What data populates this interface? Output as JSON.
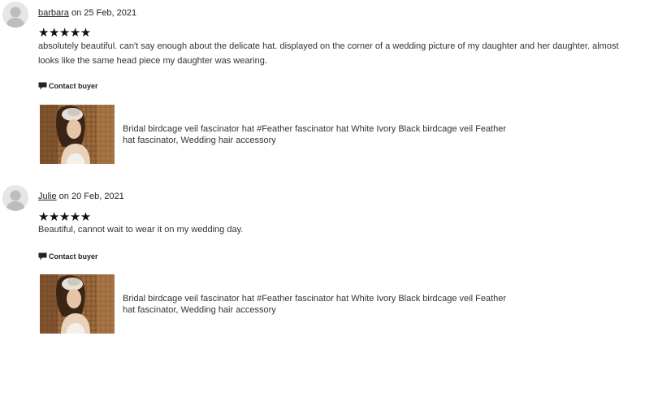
{
  "reviews": [
    {
      "reviewer": "barbara",
      "date_text": " on 25 Feb, 2021",
      "stars": "★★★★★",
      "rating": 5,
      "text": "absolutely beautiful. can't say enough about the delicate hat. displayed on the corner of a wedding picture of my daughter and her daughter. almost looks like the same head piece my daughter was wearing.",
      "contact_label": "Contact buyer",
      "item_title": "Bridal birdcage veil fascinator hat #Feather fascinator hat White Ivory Black birdcage veil Feather hat fascinator, Wedding hair accessory"
    },
    {
      "reviewer": "Julie",
      "date_text": " on 20 Feb, 2021",
      "stars": "★★★★★",
      "rating": 5,
      "text": "Beautiful, cannot wait to wear it on my wedding day.",
      "contact_label": "Contact buyer",
      "item_title": "Bridal birdcage veil fascinator hat #Feather fascinator hat White Ivory Black birdcage veil Feather hat fascinator, Wedding hair accessory"
    }
  ],
  "icons": {
    "avatar": "default-user-avatar",
    "contact": "message-bubble-icon"
  }
}
